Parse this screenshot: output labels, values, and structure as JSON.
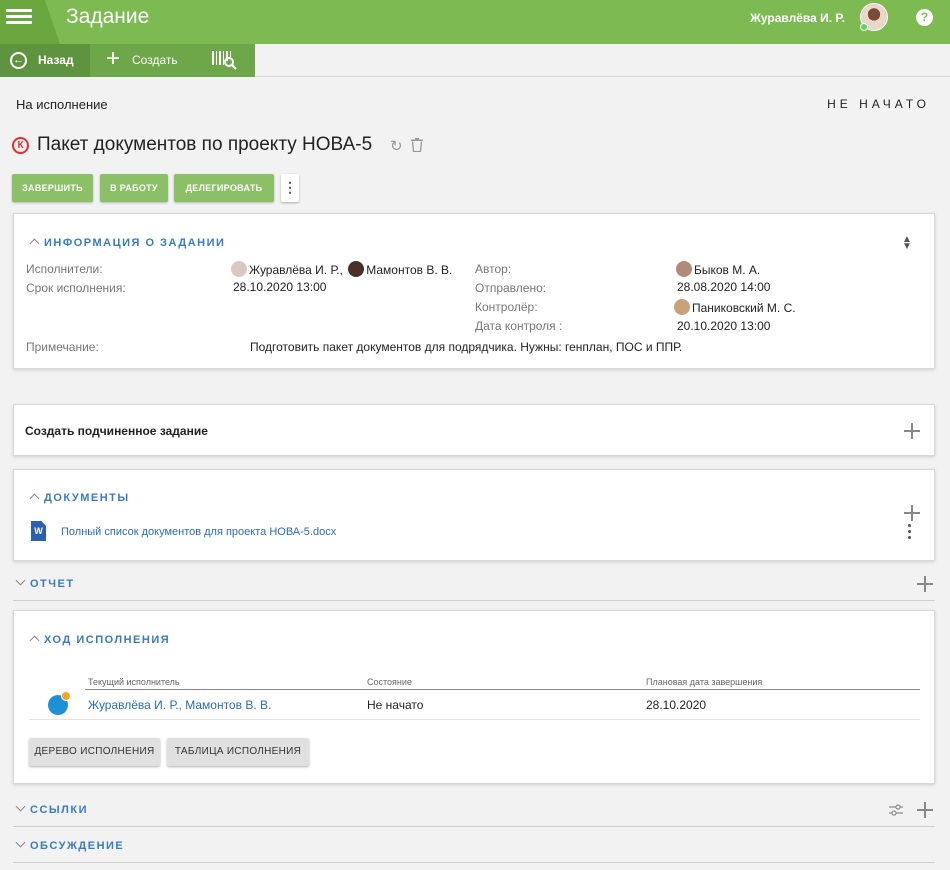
{
  "header": {
    "title": "Задание",
    "user_name": "Журавлёва И. Р.",
    "help": "?"
  },
  "toolbar": {
    "back_label": "Назад",
    "create_label": "Создать"
  },
  "status": {
    "left": "На исполнение",
    "right": "НЕ НАЧАТО"
  },
  "task": {
    "badge": "К",
    "title": "Пакет документов по проекту НОВА-5"
  },
  "actions": {
    "complete": "ЗАВЕРШИТЬ",
    "in_work": "В РАБОТУ",
    "delegate": "ДЕЛЕГИРОВАТЬ",
    "more": "⋮"
  },
  "info": {
    "section_title": "ИНФОРМАЦИЯ О ЗАДАНИИ",
    "executors_label": "Исполнители:",
    "executor_1": "Журавлёва И. Р.,",
    "executor_2": "Мамонтов В. В.",
    "deadline_label": "Срок исполнения:",
    "deadline": "28.10.2020 13:00",
    "author_label": "Автор:",
    "author": "Быков М. А.",
    "sent_label": "Отправлено:",
    "sent": "28.08.2020 14:00",
    "controller_label": "Контролёр:",
    "controller": "Паниковский М. С.",
    "control_date_label": "Дата контроля :",
    "control_date": "20.10.2020 13:00",
    "note_label": "Примечание:",
    "note": "Подготовить пакет документов для подрядчика. Нужны: генплан, ПОС и ППР."
  },
  "subtask": {
    "label": "Создать подчиненное задание"
  },
  "documents": {
    "section_title": "ДОКУМЕНТЫ",
    "file_icon": "W",
    "file_name": "Полный список документов для проекта НОВА-5.docx"
  },
  "report": {
    "section_title": "ОТЧЕТ"
  },
  "progress": {
    "section_title": "ХОД ИСПОЛНЕНИЯ",
    "col_executor": "Текущий исполнитель",
    "col_state": "Состояние",
    "col_date": "Плановая дата завершения",
    "row_executor": "Журавлёва И. Р., Мамонтов В. В.",
    "row_state": "Не начато",
    "row_date": "28.10.2020",
    "tree_button": "ДЕРЕВО ИСПОЛНЕНИЯ",
    "table_button": "ТАБЛИЦА ИСПОЛНЕНИЯ"
  },
  "links": {
    "section_title": "ССЫЛКИ"
  },
  "discussion": {
    "section_title": "ОБСУЖДЕНИЕ"
  },
  "colors": {
    "header_green": "#7dbb52",
    "button_green": "#8bc066",
    "link_blue": "#3a7bc0",
    "badge_red": "#e03131"
  }
}
